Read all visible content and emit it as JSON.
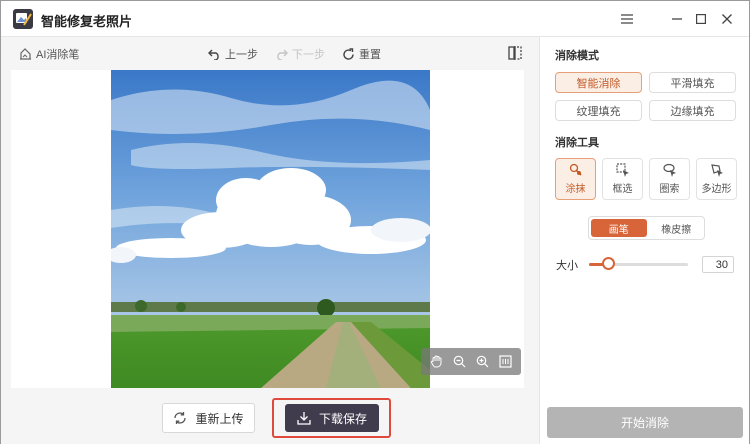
{
  "window": {
    "title": "智能修复老照片",
    "menu_icon": "hamburger-icon",
    "minimize_icon": "minimize-icon",
    "maximize_icon": "maximize-icon",
    "close_icon": "close-icon"
  },
  "toolbar": {
    "ai_eraser_label": "AI消除笔",
    "undo_label": "上一步",
    "redo_label": "下一步",
    "reset_label": "重置",
    "compare_icon": "compare-icon"
  },
  "zoom_controls": {
    "pan_icon": "hand-icon",
    "zoom_out_icon": "zoom-out-icon",
    "zoom_in_icon": "zoom-in-icon",
    "fit_icon": "fit-screen-icon"
  },
  "actions": {
    "reupload_label": "重新上传",
    "save_label": "下载保存"
  },
  "panel": {
    "mode_title": "消除模式",
    "modes": [
      {
        "label": "智能消除",
        "active": true
      },
      {
        "label": "平滑填充",
        "active": false
      },
      {
        "label": "纹理填充",
        "active": false
      },
      {
        "label": "边缘填充",
        "active": false
      }
    ],
    "tool_title": "消除工具",
    "tools": [
      {
        "label": "涂抹",
        "icon": "brush-icon",
        "active": true
      },
      {
        "label": "框选",
        "icon": "box-select-icon",
        "active": false
      },
      {
        "label": "圈索",
        "icon": "lasso-icon",
        "active": false
      },
      {
        "label": "多边形",
        "icon": "polygon-icon",
        "active": false
      }
    ],
    "brush_modes": [
      {
        "label": "画笔",
        "active": true
      },
      {
        "label": "橡皮擦",
        "active": false
      }
    ],
    "size_label": "大小",
    "size_value": "30",
    "size_fraction": 0.2,
    "start_label": "开始消除"
  },
  "colors": {
    "accent": "#d8643a",
    "save_button": "#403b4d",
    "highlight_border": "#e04a3c",
    "start_button_disabled": "#b4b4b4"
  }
}
